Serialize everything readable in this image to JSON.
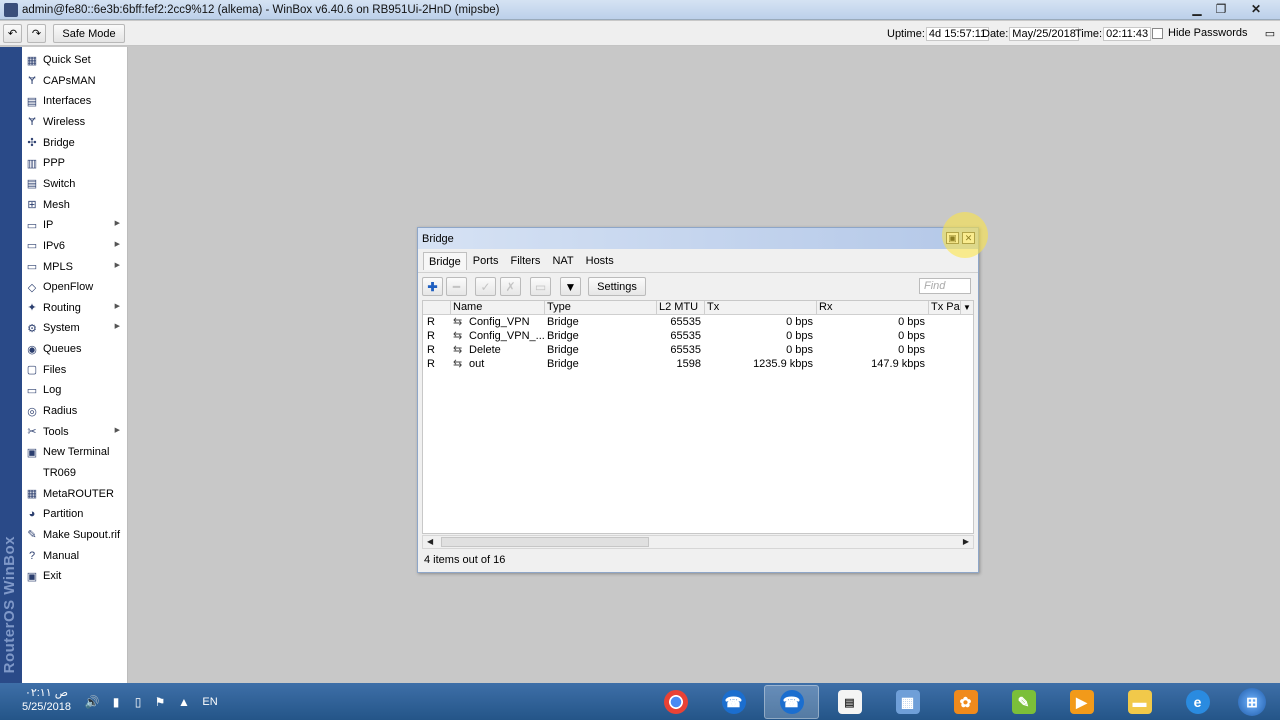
{
  "window": {
    "title": "admin@fe80::6e3b:6bff:fef2:2cc9%12 (alkema) - WinBox v6.40.6 on RB951Ui-2HnD (mipsbe)"
  },
  "toolbar": {
    "undo_icon": "undo-icon",
    "redo_icon": "redo-icon",
    "safe_mode_label": "Safe Mode",
    "uptime_label": "Uptime:",
    "uptime_value": "4d 15:57:11",
    "date_label": "Date:",
    "date_value": "May/25/2018",
    "time_label": "Time:",
    "time_value": "02:11:43",
    "hide_passwords_label": "Hide Passwords"
  },
  "side_label": "RouterOS WinBox",
  "sidebar": {
    "items": [
      {
        "label": "Quick Set",
        "icon": "quick-set-icon",
        "submenu": false
      },
      {
        "label": "CAPsMAN",
        "icon": "capsman-icon",
        "submenu": false
      },
      {
        "label": "Interfaces",
        "icon": "interfaces-icon",
        "submenu": false
      },
      {
        "label": "Wireless",
        "icon": "wireless-icon",
        "submenu": false
      },
      {
        "label": "Bridge",
        "icon": "bridge-icon",
        "submenu": false
      },
      {
        "label": "PPP",
        "icon": "ppp-icon",
        "submenu": false
      },
      {
        "label": "Switch",
        "icon": "switch-icon",
        "submenu": false
      },
      {
        "label": "Mesh",
        "icon": "mesh-icon",
        "submenu": false
      },
      {
        "label": "IP",
        "icon": "ip-icon",
        "submenu": true
      },
      {
        "label": "IPv6",
        "icon": "ipv6-icon",
        "submenu": true
      },
      {
        "label": "MPLS",
        "icon": "mpls-icon",
        "submenu": true
      },
      {
        "label": "OpenFlow",
        "icon": "openflow-icon",
        "submenu": false
      },
      {
        "label": "Routing",
        "icon": "routing-icon",
        "submenu": true
      },
      {
        "label": "System",
        "icon": "system-icon",
        "submenu": true
      },
      {
        "label": "Queues",
        "icon": "queues-icon",
        "submenu": false
      },
      {
        "label": "Files",
        "icon": "files-icon",
        "submenu": false
      },
      {
        "label": "Log",
        "icon": "log-icon",
        "submenu": false
      },
      {
        "label": "Radius",
        "icon": "radius-icon",
        "submenu": false
      },
      {
        "label": "Tools",
        "icon": "tools-icon",
        "submenu": true
      },
      {
        "label": "New Terminal",
        "icon": "terminal-icon",
        "submenu": false
      },
      {
        "label": "TR069",
        "icon": "",
        "submenu": false
      },
      {
        "label": "MetaROUTER",
        "icon": "metarouter-icon",
        "submenu": false
      },
      {
        "label": "Partition",
        "icon": "partition-icon",
        "submenu": false
      },
      {
        "label": "Make Supout.rif",
        "icon": "supout-icon",
        "submenu": false
      },
      {
        "label": "Manual",
        "icon": "manual-icon",
        "submenu": false
      },
      {
        "label": "Exit",
        "icon": "exit-icon",
        "submenu": false
      }
    ]
  },
  "bridge_window": {
    "title": "Bridge",
    "tabs": [
      "Bridge",
      "Ports",
      "Filters",
      "NAT",
      "Hosts"
    ],
    "active_tab": "Bridge",
    "settings_label": "Settings",
    "find_placeholder": "Find",
    "columns": [
      "Name",
      "Type",
      "L2 MTU",
      "Tx",
      "Rx",
      "Tx Pac"
    ],
    "rows": [
      {
        "flag": "R",
        "name": "Config_VPN",
        "type": "Bridge",
        "l2mtu": "65535",
        "tx": "0 bps",
        "rx": "0 bps"
      },
      {
        "flag": "R",
        "name": "Config_VPN_...",
        "type": "Bridge",
        "l2mtu": "65535",
        "tx": "0 bps",
        "rx": "0 bps"
      },
      {
        "flag": "R",
        "name": "Delete",
        "type": "Bridge",
        "l2mtu": "65535",
        "tx": "0 bps",
        "rx": "0 bps"
      },
      {
        "flag": "R",
        "name": "out",
        "type": "Bridge",
        "l2mtu": "1598",
        "tx": "1235.9 kbps",
        "rx": "147.9 kbps"
      }
    ],
    "status_text": "4 items out of 16"
  },
  "taskbar": {
    "clock_time": "۰۲:۱۱ ص",
    "clock_date": "5/25/2018",
    "language": "EN",
    "apps": [
      "chrome",
      "winbox",
      "winbox-active",
      "notepad",
      "network-tool",
      "pinnacle",
      "pen-tool",
      "media-player",
      "file-explorer",
      "internet-explorer",
      "start-orb"
    ]
  }
}
